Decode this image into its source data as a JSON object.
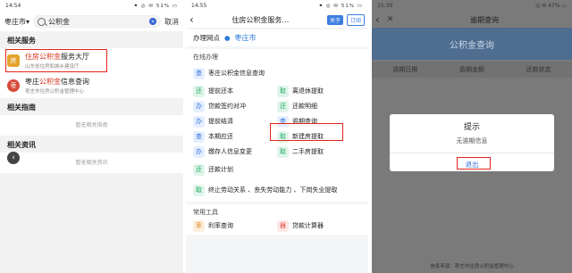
{
  "screen1": {
    "status": {
      "time": "14:54",
      "right": "⚫ ◎ ✉ 51% ▭"
    },
    "city": "枣庄市",
    "city_caret": "▾",
    "search": {
      "value": "公积金",
      "placeholder": "",
      "clear": "×",
      "cancel": "取消"
    },
    "sections": {
      "services": "相关服务",
      "guides": "相关指南",
      "news": "相关资讯"
    },
    "results": [
      {
        "icon": "房",
        "title_hl": "住房公积金",
        "title_rest": "服务大厅",
        "subtitle": "山东省住房和城乡建设厅"
      },
      {
        "icon": "枣",
        "title_prefix": "枣庄",
        "title_hl": "公积金",
        "title_rest": "信息查询",
        "subtitle": "枣庄市住房公积金管理中心"
      }
    ],
    "empty_guides": "暂无相关指南",
    "empty_news": "暂无相关资讯",
    "fab": "‹"
  },
  "screen2": {
    "status": {
      "time": "14:55",
      "right": "⚫ ◎ ✉ 51% ▭"
    },
    "back": "‹",
    "title": "住房公积金服务…",
    "about": "关于",
    "subscribe": "订阅",
    "office_label": "办理网点",
    "office_city": "枣庄市",
    "online_title": "在线办理",
    "services": [
      {
        "ic": "查",
        "color": "blue",
        "label": "枣庄公积金信息查询",
        "wide": true
      },
      {
        "ic": "还",
        "color": "green",
        "label": "提前还本"
      },
      {
        "ic": "取",
        "color": "green",
        "label": "离退休提取"
      },
      {
        "ic": "办",
        "color": "blue",
        "label": "贷款签约对冲"
      },
      {
        "ic": "还",
        "color": "green",
        "label": "还款明细"
      },
      {
        "ic": "办",
        "color": "blue",
        "label": "提前结清"
      },
      {
        "ic": "查",
        "color": "blue",
        "label": "逾期查询"
      },
      {
        "ic": "查",
        "color": "blue",
        "label": "本期应还"
      },
      {
        "ic": "取",
        "color": "green",
        "label": "新建房提取"
      },
      {
        "ic": "办",
        "color": "blue",
        "label": "缴存人信息变更"
      },
      {
        "ic": "取",
        "color": "green",
        "label": "二手房提取"
      },
      {
        "ic": "还",
        "color": "green",
        "label": "还款计划",
        "wide": true
      },
      {
        "ic": "取",
        "color": "green",
        "label": "终止劳动关系 、丧失劳动能力 、下岗失业提取",
        "wide": true
      }
    ],
    "tools_title": "常用工具",
    "tools": [
      {
        "ic": "率",
        "color": "orange",
        "label": "利率查询"
      },
      {
        "ic": "器",
        "color": "red",
        "label": "贷款计算器"
      }
    ]
  },
  "screen3": {
    "status": {
      "time": "15:39",
      "right": "◎ ✉ 47% ▭"
    },
    "back": "‹",
    "close": "✕",
    "title": "逾期查询",
    "banner": "公积金查询",
    "columns": [
      "逾期日期",
      "逾期金额",
      "还款状态"
    ],
    "modal": {
      "title": "提示",
      "message": "无逾期信息",
      "button": "退出"
    },
    "footer": "信息来源：枣庄市住房公积金管理中心"
  },
  "colors": {
    "highlight_box": "#e3241a",
    "accent_blue": "#2f6fdc",
    "keyword_red": "#d9331f"
  }
}
